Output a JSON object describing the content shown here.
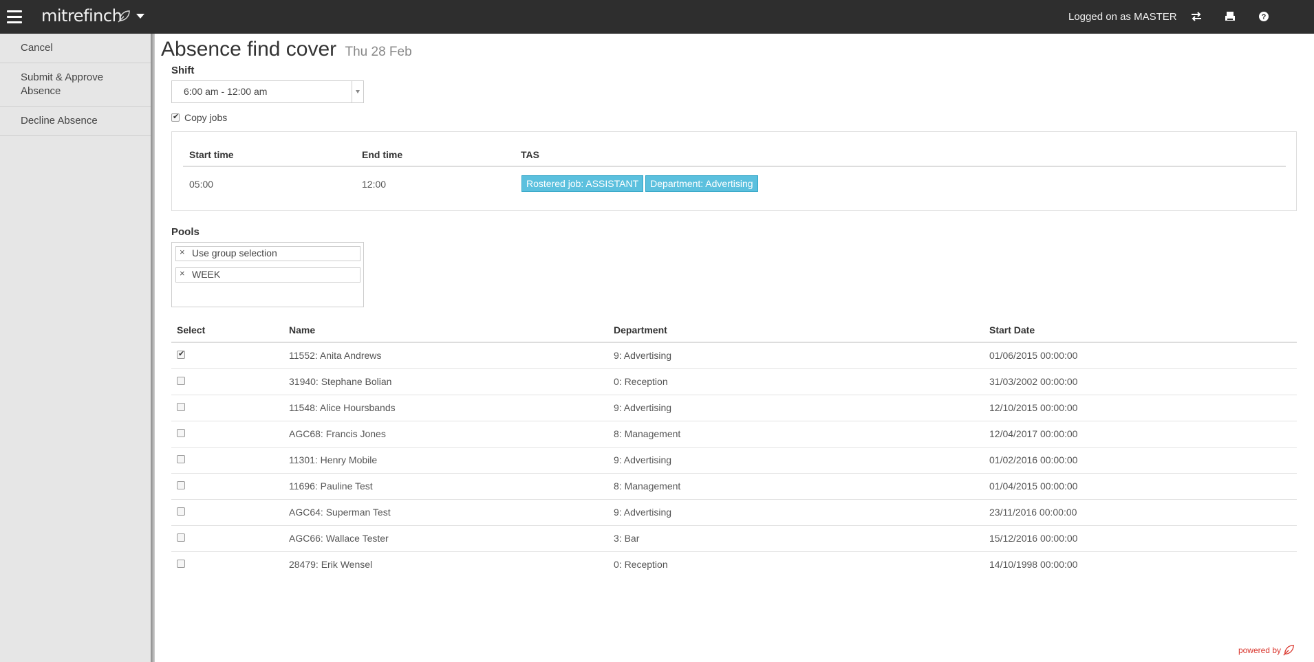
{
  "header": {
    "brand": "mitrefinch",
    "logged_on": "Logged on as MASTER",
    "icons": [
      "menu-icon",
      "feather-icon",
      "chevron-down-icon",
      "swap-icon",
      "printer-icon",
      "help-icon"
    ]
  },
  "sidebar": {
    "items": [
      {
        "label": "Cancel"
      },
      {
        "label": "Submit & Approve Absence"
      },
      {
        "label": "Decline Absence"
      }
    ]
  },
  "page": {
    "title": "Absence find cover",
    "date": "Thu 28 Feb"
  },
  "shift": {
    "label": "Shift",
    "value": "6:00 am - 12:00 am"
  },
  "copy_jobs": {
    "label": "Copy jobs",
    "checked": true
  },
  "jobs_table": {
    "headers": [
      "Start time",
      "End time",
      "TAS"
    ],
    "rows": [
      {
        "start": "05:00",
        "end": "12:00",
        "tags": [
          "Rostered job: ASSISTANT",
          "Department: Advertising"
        ]
      }
    ]
  },
  "pools": {
    "label": "Pools",
    "items": [
      "Use group selection",
      "WEEK"
    ]
  },
  "employees": {
    "headers": [
      "Select",
      "Name",
      "Department",
      "Start Date"
    ],
    "rows": [
      {
        "selected": true,
        "name": "11552: Anita Andrews",
        "department": "9: Advertising",
        "start_date": "01/06/2015 00:00:00"
      },
      {
        "selected": false,
        "name": "31940: Stephane Bolian",
        "department": "0: Reception",
        "start_date": "31/03/2002 00:00:00"
      },
      {
        "selected": false,
        "name": "11548: Alice Hoursbands",
        "department": "9: Advertising",
        "start_date": "12/10/2015 00:00:00"
      },
      {
        "selected": false,
        "name": "AGC68: Francis Jones",
        "department": "8: Management",
        "start_date": "12/04/2017 00:00:00"
      },
      {
        "selected": false,
        "name": "11301: Henry Mobile",
        "department": "9: Advertising",
        "start_date": "01/02/2016 00:00:00"
      },
      {
        "selected": false,
        "name": "11696: Pauline Test",
        "department": "8: Management",
        "start_date": "01/04/2015 00:00:00"
      },
      {
        "selected": false,
        "name": "AGC64: Superman Test",
        "department": "9: Advertising",
        "start_date": "23/11/2016 00:00:00"
      },
      {
        "selected": false,
        "name": "AGC66: Wallace Tester",
        "department": "3: Bar",
        "start_date": "15/12/2016 00:00:00"
      },
      {
        "selected": false,
        "name": "28479: Erik Wensel",
        "department": "0: Reception",
        "start_date": "14/10/1998 00:00:00"
      }
    ]
  },
  "footer": {
    "powered_by": "powered by"
  },
  "colors": {
    "topbar": "#2e2e2e",
    "sidebar": "#e6e6e6",
    "tag": "#5bc0de",
    "powered": "#d9342b"
  }
}
